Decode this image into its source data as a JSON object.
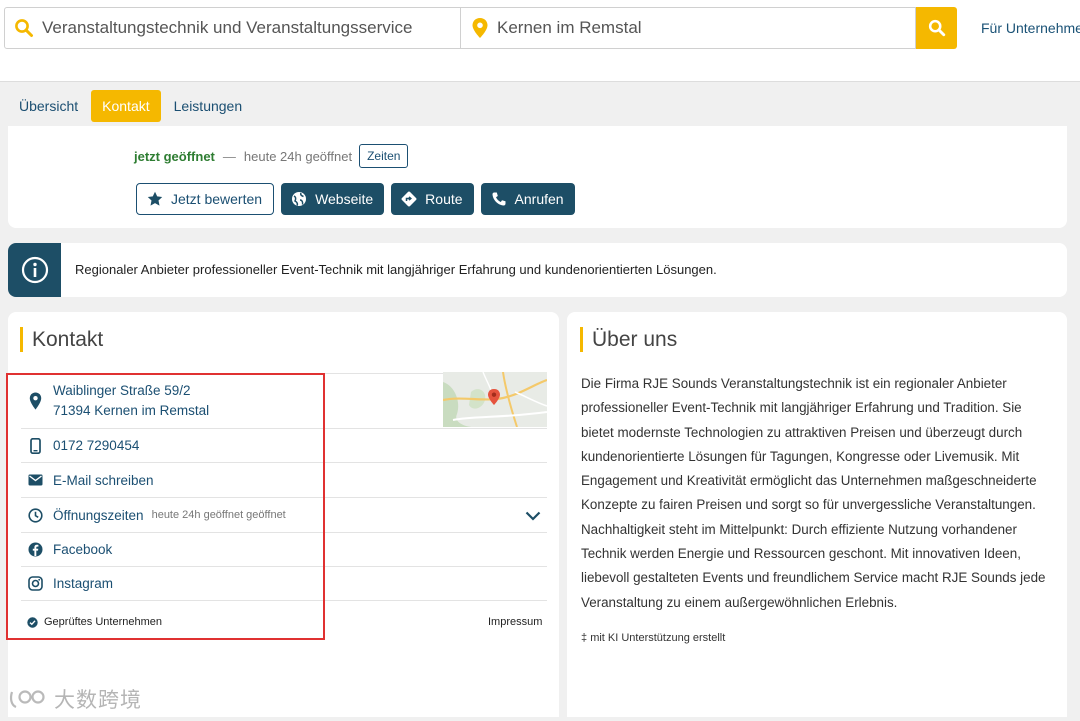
{
  "search": {
    "what_value": "Veranstaltungstechnik und Veranstaltungsservice",
    "where_value": "Kernen im Remstal",
    "business_link": "Für Unternehme"
  },
  "tabs": [
    {
      "label": "Übersicht",
      "active": false
    },
    {
      "label": "Kontakt",
      "active": true
    },
    {
      "label": "Leistungen",
      "active": false
    }
  ],
  "status": {
    "open_now": "jetzt geöffnet",
    "separator": "—",
    "today": "heute 24h geöffnet",
    "hours_button": "Zeiten"
  },
  "actions": {
    "rate": "Jetzt bewerten",
    "website": "Webseite",
    "route": "Route",
    "call": "Anrufen"
  },
  "info": {
    "text": "Regionaler Anbieter professioneller Event-Technik mit langjähriger Erfahrung und kundenorientierten Lösungen."
  },
  "kontakt": {
    "title": "Kontakt",
    "street": "Waiblinger Straße 59/2",
    "city": "71394 Kernen im Remstal",
    "phone": "0172 7290454",
    "email": "E-Mail schreiben",
    "hours_label": "Öffnungszeiten",
    "hours_status": "heute 24h geöffnet geöffnet",
    "facebook": "Facebook",
    "instagram": "Instagram",
    "verified": "Geprüftes Unternehmen",
    "impressum": "Impressum"
  },
  "ueber": {
    "title": "Über uns",
    "text": "Die Firma RJE Sounds Veranstaltungstechnik ist ein regionaler Anbieter professioneller Event-Technik mit langjähriger Erfahrung und Tradition. Sie bietet modernste Technologien zu attraktiven Preisen und überzeugt durch kundenorientierte Lösungen für Tagungen, Kongresse oder Livemusik. Mit Engagement und Kreativität ermöglicht das Unternehmen maßgeschneiderte Konzepte zu fairen Preisen und sorgt so für unvergessliche Veranstaltungen. Nachhaltigkeit steht im Mittelpunkt: Durch effiziente Nutzung vorhandener Technik werden Energie und Ressourcen geschont. Mit innovativen Ideen, liebevoll gestalteten Events und freundlichem Service macht RJE Sounds jede Veranstaltung zu einem außergewöhnlichen Erlebnis.",
    "ki_marker": "‡",
    "ki_note": "mit KI Unterstützung erstellt"
  },
  "watermark": "大数跨境",
  "colors": {
    "accent": "#f5b800",
    "primary": "#1d4e66",
    "link": "#1b4f72",
    "open_green": "#2e7d32",
    "highlight_box": "#e03131"
  },
  "icons": [
    "search-icon",
    "location-pin-icon",
    "star-icon",
    "globe-icon",
    "route-icon",
    "phone-icon",
    "info-icon",
    "mobile-phone-icon",
    "mail-icon",
    "clock-icon",
    "chevron-down-icon",
    "facebook-icon",
    "instagram-icon",
    "verified-check-icon"
  ]
}
